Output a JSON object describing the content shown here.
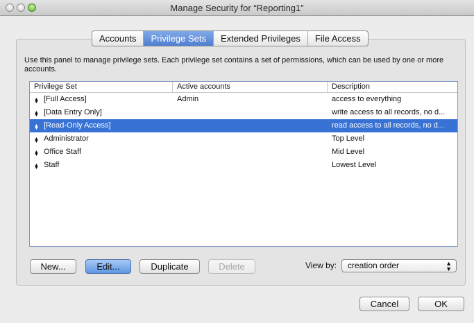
{
  "window": {
    "title": "Manage Security for “Reporting1”"
  },
  "tabs": [
    {
      "label": "Accounts",
      "active": false
    },
    {
      "label": "Privilege Sets",
      "active": true
    },
    {
      "label": "Extended Privileges",
      "active": false
    },
    {
      "label": "File Access",
      "active": false
    }
  ],
  "description": "Use this panel to manage privilege sets.  Each privilege set contains a set of permissions, which can be used by one or more accounts.",
  "table": {
    "columns": [
      "Privilege Set",
      "Active accounts",
      "Description"
    ],
    "rows": [
      {
        "name": "[Full Access]",
        "accounts": "Admin",
        "description": "access to everything",
        "selected": false
      },
      {
        "name": "[Data Entry Only]",
        "accounts": "",
        "description": "write access to all records, no d...",
        "selected": false
      },
      {
        "name": "[Read-Only Access]",
        "accounts": "",
        "description": "read access to all records, no d...",
        "selected": true
      },
      {
        "name": "Administrator",
        "accounts": "",
        "description": "Top Level",
        "selected": false
      },
      {
        "name": "Office Staff",
        "accounts": "",
        "description": "Mid Level",
        "selected": false
      },
      {
        "name": "Staff",
        "accounts": "",
        "description": "Lowest Level",
        "selected": false
      }
    ]
  },
  "buttons": {
    "new": "New...",
    "edit": "Edit...",
    "duplicate": "Duplicate",
    "delete": "Delete",
    "cancel": "Cancel",
    "ok": "OK"
  },
  "view_by": {
    "label": "View by:",
    "value": "creation order"
  },
  "colors": {
    "selection": "#3872d4",
    "default_button": "#5f98e5"
  }
}
